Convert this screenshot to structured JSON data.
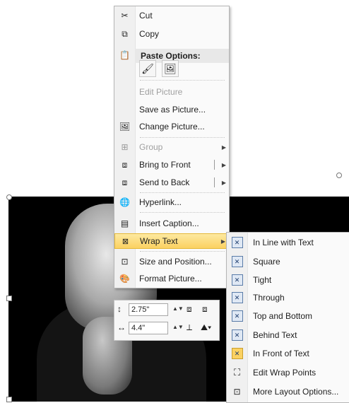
{
  "context_menu": {
    "cut": {
      "label": "Cut",
      "icon": "scissors-icon"
    },
    "copy": {
      "label": "Copy",
      "icon": "copy-icon"
    },
    "paste_options": {
      "label": "Paste Options:",
      "icon": "paste-icon"
    },
    "edit_picture": {
      "label": "Edit Picture"
    },
    "save_as_picture": {
      "label": "Save as Picture..."
    },
    "change_picture": {
      "label": "Change Picture...",
      "icon": "change-picture-icon"
    },
    "group": {
      "label": "Group",
      "icon": "group-icon"
    },
    "bring_to_front": {
      "label": "Bring to Front",
      "icon": "bring-to-front-icon"
    },
    "send_to_back": {
      "label": "Send to Back",
      "icon": "send-to-back-icon"
    },
    "hyperlink": {
      "label": "Hyperlink...",
      "icon": "hyperlink-icon"
    },
    "insert_caption": {
      "label": "Insert Caption...",
      "icon": "caption-icon"
    },
    "wrap_text": {
      "label": "Wrap Text",
      "icon": "wrap-text-icon"
    },
    "size_and_position": {
      "label": "Size and Position...",
      "icon": "size-position-icon"
    },
    "format_picture": {
      "label": "Format Picture...",
      "icon": "format-picture-icon"
    }
  },
  "mini_toolbar": {
    "height_value": "2.75\"",
    "width_value": "4.4\""
  },
  "wrap_submenu": {
    "items": [
      {
        "label": "In Line with Text"
      },
      {
        "label": "Square"
      },
      {
        "label": "Tight"
      },
      {
        "label": "Through"
      },
      {
        "label": "Top and Bottom"
      },
      {
        "label": "Behind Text"
      },
      {
        "label": "In Front of Text"
      },
      {
        "label": "Edit Wrap Points"
      },
      {
        "label": "More Layout Options..."
      }
    ]
  },
  "colors": {
    "highlight": "#fbd161",
    "menu_bg": "#fafafa",
    "gutter": "#f0f0f0"
  }
}
